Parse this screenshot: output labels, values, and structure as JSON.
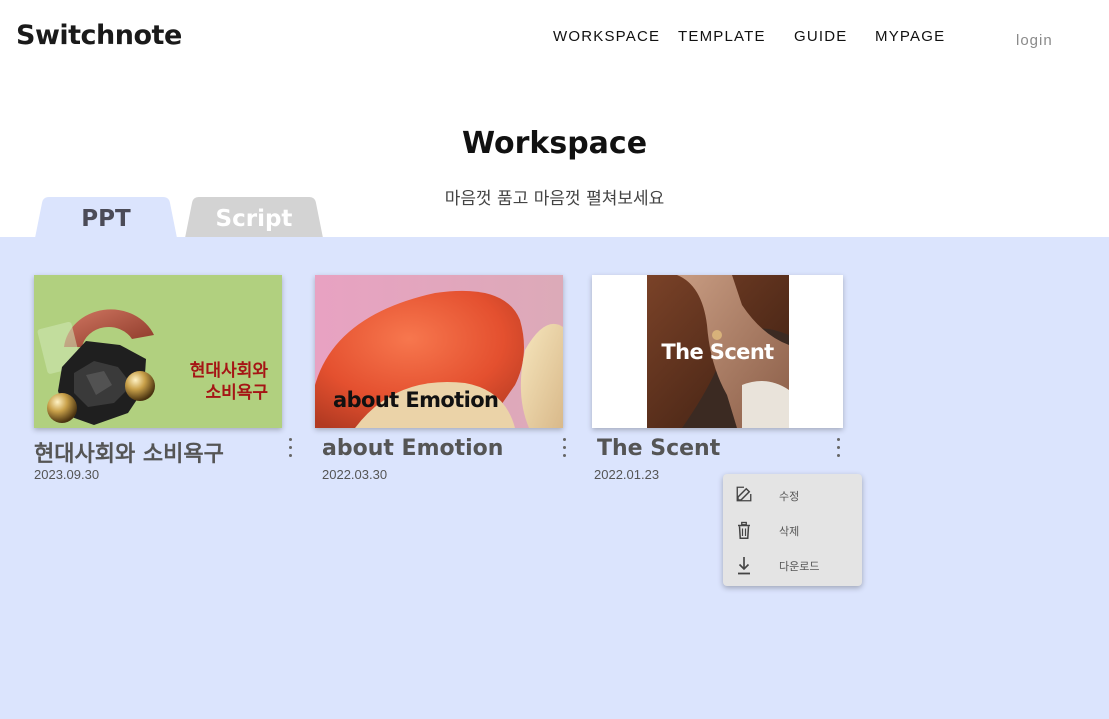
{
  "header": {
    "logo": "Switchnote",
    "nav": [
      "WORKSPACE",
      "TEMPLATE",
      "GUIDE",
      "MYPAGE"
    ],
    "login": "login"
  },
  "page": {
    "title": "Workspace",
    "subtitle": "마음껏 품고 마음껏 펼쳐보세요"
  },
  "tabs": [
    {
      "label": "PPT",
      "active": true,
      "color": "#dbe4fd"
    },
    {
      "label": "Script",
      "active": false,
      "color": "#d3d3d3"
    }
  ],
  "colors": {
    "content_bg": "#dbe4fd",
    "menu_bg": "#e4e4e4"
  },
  "cards": [
    {
      "title": "현대사회와 소비욕구",
      "date": "2023.09.30",
      "thumb_text_line1": "현대사회와",
      "thumb_text_line2": "소비욕구",
      "thumb_color": "#b1d07f"
    },
    {
      "title": "about Emotion",
      "date": "2022.03.30",
      "thumb_text": "about Emotion",
      "thumb_color": "#e7a4c0"
    },
    {
      "title": "The Scent",
      "date": "2022.01.23",
      "thumb_text": "The Scent",
      "thumb_color": "#ffffff"
    }
  ],
  "menu": {
    "items": [
      {
        "label": "수정",
        "icon": "edit-icon"
      },
      {
        "label": "삭제",
        "icon": "trash-icon"
      },
      {
        "label": "다운로드",
        "icon": "download-icon"
      }
    ]
  }
}
